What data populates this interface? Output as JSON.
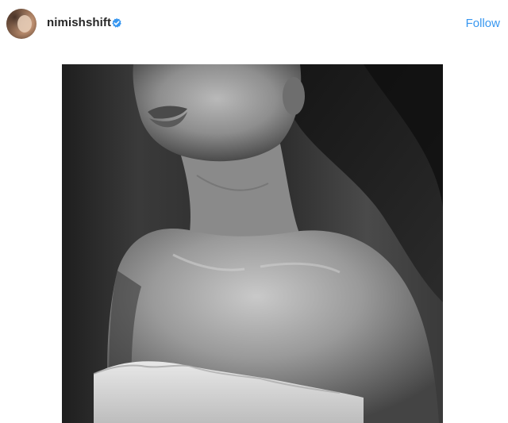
{
  "post": {
    "username": "nimishshift",
    "verified": true,
    "follow_label": "Follow",
    "accent_color": "#3897f0"
  },
  "icons": {
    "avatar": "profile-avatar",
    "verified": "verified-badge-icon"
  }
}
